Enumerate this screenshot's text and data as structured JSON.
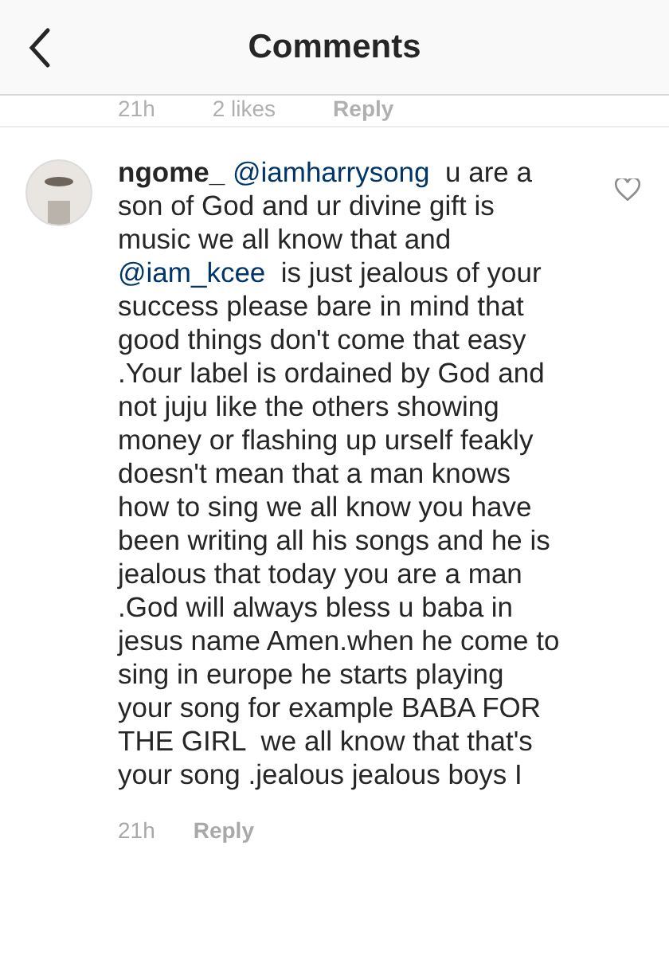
{
  "header": {
    "title": "Comments"
  },
  "previous_comment": {
    "time": "21h",
    "likes": "2 likes",
    "reply": "Reply"
  },
  "comment": {
    "username": "ngome_",
    "liked": false,
    "segments": [
      {
        "kind": "mention",
        "text": "@iamharrysong"
      },
      {
        "kind": "text",
        "text": "  u are a son of God and ur divine gift is music we all know that and "
      },
      {
        "kind": "mention",
        "text": "@iam_kcee"
      },
      {
        "kind": "text",
        "text": "  is just jealous of your success please bare in mind that good things don't come that easy .Your label is ordained by God and not juju like the others showing money or flashing up urself feakly doesn't mean that a man knows how to sing we all know you have been writing all his songs and he is jealous that today you are a man .God will always bless u baba in jesus name Amen.when he come to sing in europe he starts playing your song for example BABA FOR THE GIRL  we all know that that's your song .jealous jealous boys I"
      }
    ],
    "time": "21h",
    "reply": "Reply"
  }
}
